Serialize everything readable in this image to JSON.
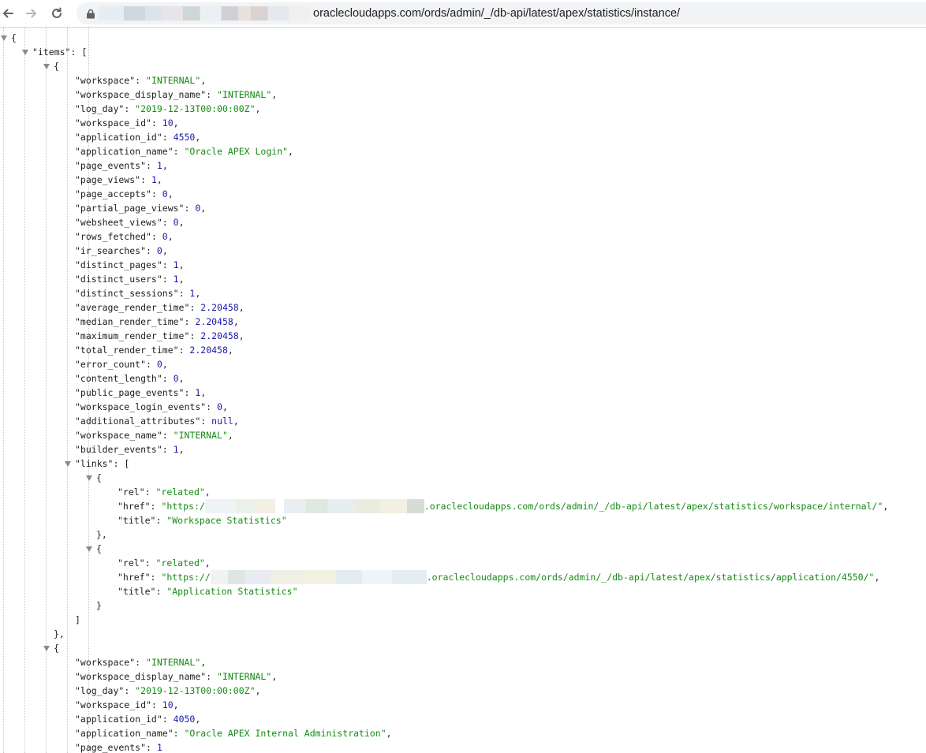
{
  "browser": {
    "url_visible": "oraclecloudapps.com/ords/admin/_/db-api/latest/apex/statistics/instance/",
    "icons": [
      "back-arrow-icon",
      "forward-arrow-icon",
      "reload-icon",
      "lock-icon"
    ]
  },
  "json_root": {
    "items_key": "items",
    "items": [
      {
        "fields": [
          {
            "key": "workspace",
            "value": "INTERNAL",
            "type": "string"
          },
          {
            "key": "workspace_display_name",
            "value": "INTERNAL",
            "type": "string"
          },
          {
            "key": "log_day",
            "value": "2019-12-13T00:00:00Z",
            "type": "string"
          },
          {
            "key": "workspace_id",
            "value": "10",
            "type": "number"
          },
          {
            "key": "application_id",
            "value": "4550",
            "type": "number"
          },
          {
            "key": "application_name",
            "value": "Oracle APEX Login",
            "type": "string"
          },
          {
            "key": "page_events",
            "value": "1",
            "type": "number"
          },
          {
            "key": "page_views",
            "value": "1",
            "type": "number"
          },
          {
            "key": "page_accepts",
            "value": "0",
            "type": "number"
          },
          {
            "key": "partial_page_views",
            "value": "0",
            "type": "number"
          },
          {
            "key": "websheet_views",
            "value": "0",
            "type": "number"
          },
          {
            "key": "rows_fetched",
            "value": "0",
            "type": "number"
          },
          {
            "key": "ir_searches",
            "value": "0",
            "type": "number"
          },
          {
            "key": "distinct_pages",
            "value": "1",
            "type": "number"
          },
          {
            "key": "distinct_users",
            "value": "1",
            "type": "number"
          },
          {
            "key": "distinct_sessions",
            "value": "1",
            "type": "number"
          },
          {
            "key": "average_render_time",
            "value": "2.20458",
            "type": "number"
          },
          {
            "key": "median_render_time",
            "value": "2.20458",
            "type": "number"
          },
          {
            "key": "maximum_render_time",
            "value": "2.20458",
            "type": "number"
          },
          {
            "key": "total_render_time",
            "value": "2.20458",
            "type": "number"
          },
          {
            "key": "error_count",
            "value": "0",
            "type": "number"
          },
          {
            "key": "content_length",
            "value": "0",
            "type": "number"
          },
          {
            "key": "public_page_events",
            "value": "1",
            "type": "number"
          },
          {
            "key": "workspace_login_events",
            "value": "0",
            "type": "number"
          },
          {
            "key": "additional_attributes",
            "value": "null",
            "type": "null"
          },
          {
            "key": "workspace_name",
            "value": "INTERNAL",
            "type": "string"
          },
          {
            "key": "builder_events",
            "value": "1",
            "type": "number"
          }
        ],
        "links_key": "links",
        "links": [
          {
            "rel": "related",
            "href_prefix": "\"https:/",
            "href_suffix": ".oraclecloudapps.com/ords/admin/_/db-api/latest/apex/statistics/workspace/internal/\"",
            "title": "Workspace Statistics"
          },
          {
            "rel": "related",
            "href_prefix": "\"https://",
            "href_suffix": ".oraclecloudapps.com/ords/admin/_/db-api/latest/apex/statistics/application/4550/\"",
            "title": "Application Statistics"
          }
        ]
      },
      {
        "fields": [
          {
            "key": "workspace",
            "value": "INTERNAL",
            "type": "string"
          },
          {
            "key": "workspace_display_name",
            "value": "INTERNAL",
            "type": "string"
          },
          {
            "key": "log_day",
            "value": "2019-12-13T00:00:00Z",
            "type": "string"
          },
          {
            "key": "workspace_id",
            "value": "10",
            "type": "number"
          },
          {
            "key": "application_id",
            "value": "4050",
            "type": "number"
          },
          {
            "key": "application_name",
            "value": "Oracle APEX Internal Administration",
            "type": "string"
          },
          {
            "key": "page_events",
            "value": "1",
            "type": "number"
          }
        ]
      }
    ]
  },
  "colors": {
    "string": "#168a16",
    "number": "#1a1aa6",
    "key": "#202020",
    "toggle": "#8a8a8a"
  }
}
